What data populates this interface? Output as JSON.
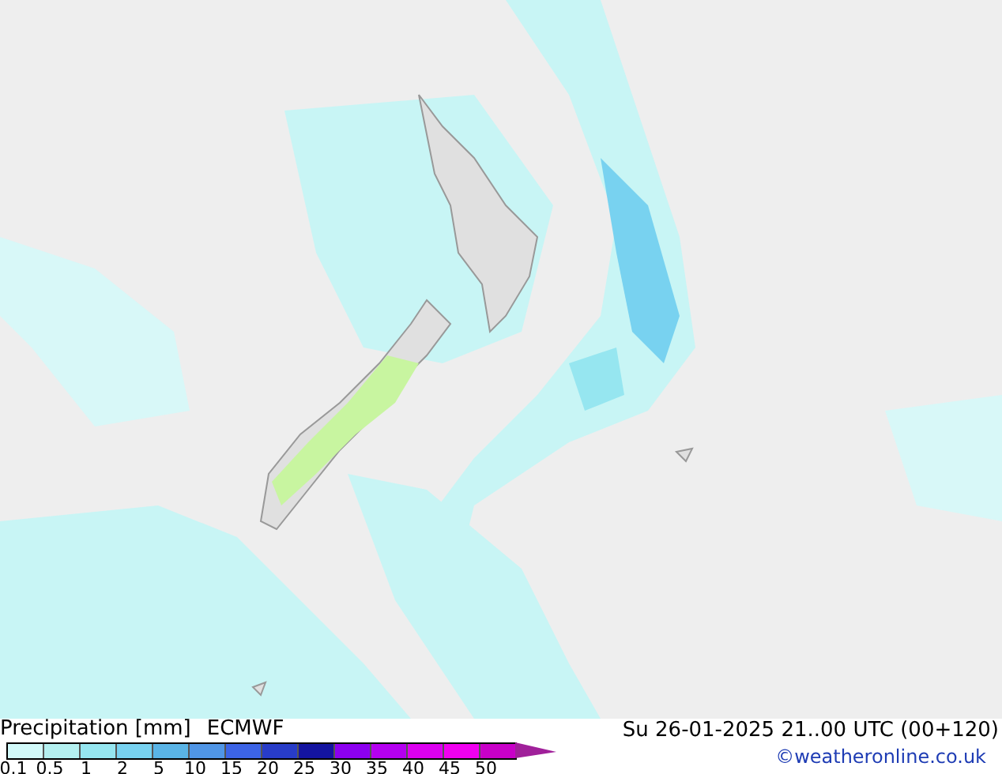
{
  "legend": {
    "title": "Precipitation [mm]",
    "model": "ECMWF",
    "segments": [
      {
        "color": "#d2fafa"
      },
      {
        "color": "#b4f0f0"
      },
      {
        "color": "#96e6f0"
      },
      {
        "color": "#78d2f0"
      },
      {
        "color": "#5ab4e6"
      },
      {
        "color": "#5096e6"
      },
      {
        "color": "#3c64e6"
      },
      {
        "color": "#283cc8"
      },
      {
        "color": "#1414a0"
      },
      {
        "color": "#8c00f0"
      },
      {
        "color": "#b400f0"
      },
      {
        "color": "#dc00f0"
      },
      {
        "color": "#f000f0"
      },
      {
        "color": "#c800c8"
      }
    ],
    "ticks": [
      "0.1",
      "0.5",
      "1",
      "2",
      "5",
      "10",
      "15",
      "20",
      "25",
      "30",
      "35",
      "40",
      "45",
      "50"
    ]
  },
  "valid_time": "Su 26-01-2025 21..00 UTC (00+120)",
  "credit": "©weatheronline.co.uk"
}
